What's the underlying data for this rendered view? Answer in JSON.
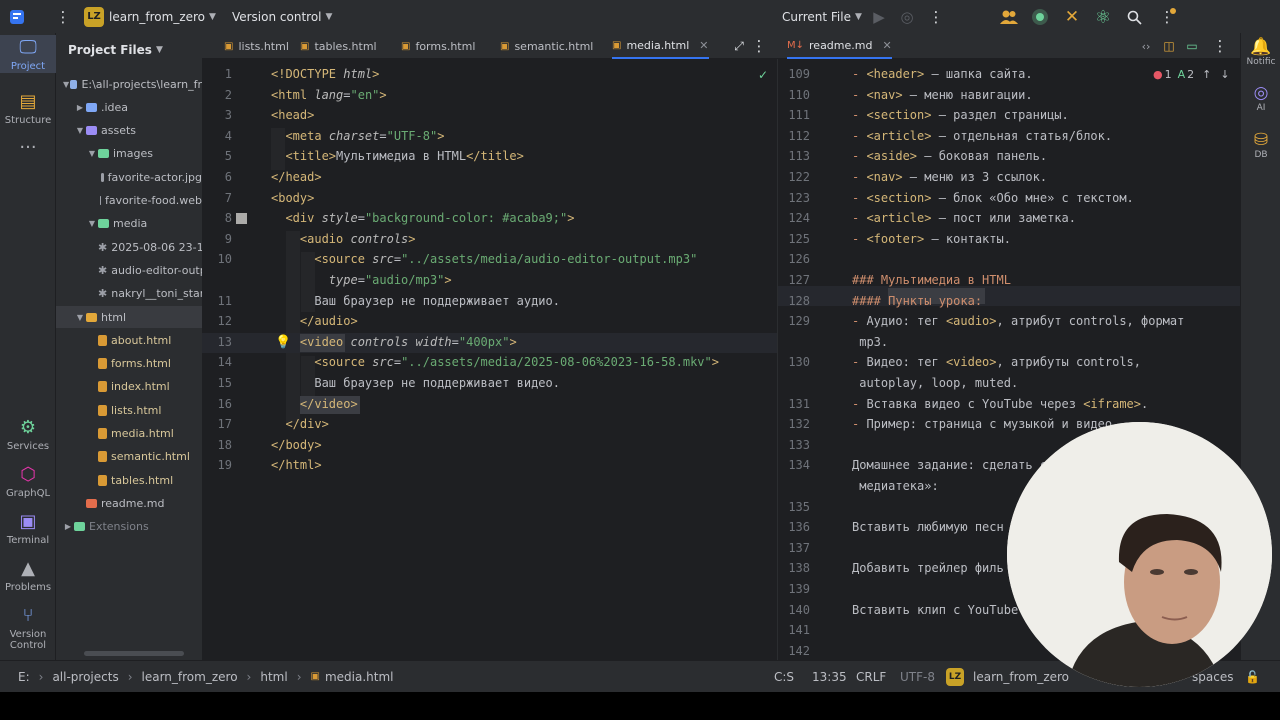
{
  "titlebar": {
    "project_badge": "LZ",
    "project_name": "learn_from_zero",
    "vcs": "Version control",
    "run_config": "Current File"
  },
  "left_tools": [
    {
      "label": "Project",
      "icon": "monitor-icon"
    },
    {
      "label": "Structure",
      "icon": "structure-icon"
    },
    {
      "label": "Services",
      "icon": "gear-icon"
    },
    {
      "label": "GraphQL",
      "icon": "graphql-icon"
    },
    {
      "label": "Terminal",
      "icon": "terminal-icon"
    },
    {
      "label": "Problems",
      "icon": "warning-icon"
    },
    {
      "label": "Version Control",
      "icon": "branch-icon"
    }
  ],
  "project_panel": {
    "title": "Project Files",
    "tree": [
      {
        "label": "E:\\all-projects\\learn_fr",
        "level": 0,
        "kind": "folder-root"
      },
      {
        "label": ".idea",
        "level": 1,
        "kind": "folder"
      },
      {
        "label": "assets",
        "level": 1,
        "kind": "folder"
      },
      {
        "label": "images",
        "level": 2,
        "kind": "folder"
      },
      {
        "label": "favorite-actor.jpg",
        "level": 3,
        "kind": "image"
      },
      {
        "label": "favorite-food.web",
        "level": 3,
        "kind": "image"
      },
      {
        "label": "media",
        "level": 2,
        "kind": "folder"
      },
      {
        "label": "2025-08-06 23-1",
        "level": 3,
        "kind": "media"
      },
      {
        "label": "audio-editor-outp",
        "level": 3,
        "kind": "media"
      },
      {
        "label": "nakryl__toni_stark",
        "level": 3,
        "kind": "media"
      },
      {
        "label": "html",
        "level": 1,
        "kind": "folder"
      },
      {
        "label": "about.html",
        "level": 2,
        "kind": "html"
      },
      {
        "label": "forms.html",
        "level": 2,
        "kind": "html"
      },
      {
        "label": "index.html",
        "level": 2,
        "kind": "html"
      },
      {
        "label": "lists.html",
        "level": 2,
        "kind": "html"
      },
      {
        "label": "media.html",
        "level": 2,
        "kind": "html"
      },
      {
        "label": "semantic.html",
        "level": 2,
        "kind": "html"
      },
      {
        "label": "tables.html",
        "level": 2,
        "kind": "html"
      },
      {
        "label": "readme.md",
        "level": 1,
        "kind": "md"
      },
      {
        "label": "Extensions",
        "level": 0,
        "kind": "ext"
      }
    ]
  },
  "tabs_left": [
    "lists.html",
    "tables.html",
    "forms.html",
    "semantic.html",
    "media.html"
  ],
  "active_tab": "media.html",
  "tab_right": "readme.md",
  "editor_left": {
    "lines": [
      {
        "n": "1",
        "html": "<span class=\"t\">&lt;!DOCTYPE </span><span class=\"a\">html</span><span class=\"t\">&gt;</span>"
      },
      {
        "n": "2",
        "html": "<span class=\"t\">&lt;html </span><span class=\"a\">lang</span>=<span class=\"s\">\"en\"</span><span class=\"t\">&gt;</span>"
      },
      {
        "n": "3",
        "html": "<span class=\"t\">&lt;head&gt;</span>"
      },
      {
        "n": "4",
        "html": "  <span class=\"t\">&lt;meta </span><span class=\"a\">charset</span>=<span class=\"s\">\"UTF-8\"</span><span class=\"t\">&gt;</span>"
      },
      {
        "n": "5",
        "html": "  <span class=\"t\">&lt;title&gt;</span>Мультимедиа в HTML<span class=\"t\">&lt;/title&gt;</span>"
      },
      {
        "n": "6",
        "html": "<span class=\"t\">&lt;/head&gt;</span>"
      },
      {
        "n": "7",
        "html": "<span class=\"t\">&lt;body&gt;</span>"
      },
      {
        "n": "8",
        "html": "  <span class=\"t\">&lt;div </span><span class=\"a\">style</span>=<span class=\"s\">\"background-color: #acaba9;\"</span><span class=\"t\">&gt;</span>"
      },
      {
        "n": "9",
        "html": "    <span class=\"t\">&lt;audio </span><span class=\"a\">controls</span><span class=\"t\">&gt;</span>"
      },
      {
        "n": "10",
        "html": "      <span class=\"t\">&lt;source </span><span class=\"a\">src</span>=<span class=\"s\">\"../assets/media/audio-editor-output.mp3\"</span>"
      },
      {
        "n": "",
        "html": "        <span class=\"a\">type</span>=<span class=\"s\">\"audio/mp3\"</span><span class=\"t\">&gt;</span>"
      },
      {
        "n": "11",
        "html": "      Ваш браузер не поддерживает аудио."
      },
      {
        "n": "12",
        "html": "    <span class=\"t\">&lt;/audio&gt;</span>"
      },
      {
        "n": "13",
        "html": "    <span class=\"t\">&lt;video </span><span class=\"a\">controls</span> <span class=\"a\">width</span>=<span class=\"s\">\"400px\"</span><span class=\"t\">&gt;</span>"
      },
      {
        "n": "14",
        "html": "      <span class=\"t\">&lt;source </span><span class=\"a\">src</span>=<span class=\"s\">\"../assets/media/2025-08-06%2023-16-58.mkv\"</span><span class=\"t\">&gt;</span>"
      },
      {
        "n": "15",
        "html": "      Ваш браузер не поддерживает видео."
      },
      {
        "n": "16",
        "html": "    <span class=\"t\">&lt;/video&gt;</span>"
      },
      {
        "n": "17",
        "html": "  <span class=\"t\">&lt;/div&gt;</span>"
      },
      {
        "n": "18",
        "html": "<span class=\"t\">&lt;/body&gt;</span>"
      },
      {
        "n": "19",
        "html": "<span class=\"t\">&lt;/html&gt;</span>"
      }
    ]
  },
  "editor_right": {
    "problems": "1",
    "warnings": "2",
    "lines": [
      {
        "n": "109",
        "html": "<span class=\"bul\">- </span><span class=\"t\">&lt;header&gt;</span> — шапка сайта."
      },
      {
        "n": "110",
        "html": "<span class=\"bul\">- </span><span class=\"t\">&lt;nav&gt;</span> — меню навигации."
      },
      {
        "n": "111",
        "html": "<span class=\"bul\">- </span><span class=\"t\">&lt;section&gt;</span> — раздел страницы."
      },
      {
        "n": "112",
        "html": "<span class=\"bul\">- </span><span class=\"t\">&lt;article&gt;</span> — отдельная статья/блок."
      },
      {
        "n": "113",
        "html": "<span class=\"bul\">- </span><span class=\"t\">&lt;aside&gt;</span> — боковая панель."
      },
      {
        "n": "122",
        "html": "<span class=\"bul\">- </span><span class=\"t\">&lt;nav&gt;</span> — меню из 3 ссылок."
      },
      {
        "n": "123",
        "html": "<span class=\"bul\">- </span><span class=\"t\">&lt;section&gt;</span> — блок «Обо мне» с текстом."
      },
      {
        "n": "124",
        "html": "<span class=\"bul\">- </span><span class=\"t\">&lt;article&gt;</span> — пост или заметка."
      },
      {
        "n": "125",
        "html": "<span class=\"bul\">- </span><span class=\"t\">&lt;footer&gt;</span> — контакты."
      },
      {
        "n": "126",
        "html": ""
      },
      {
        "n": "127",
        "html": "<span class=\"h\">### Мультимедиа в HTML</span>"
      },
      {
        "n": "128",
        "html": "<span class=\"h\">#### Пункты урока:</span>"
      },
      {
        "n": "129",
        "html": "<span class=\"bul\">- </span>Аудио: тег <span class=\"t\">&lt;audio&gt;</span>, атрибут controls, формат"
      },
      {
        "n": "",
        "html": " mp3."
      },
      {
        "n": "130",
        "html": "<span class=\"bul\">- </span>Видео: тег <span class=\"t\">&lt;video&gt;</span>, атрибуты controls,"
      },
      {
        "n": "",
        "html": " autoplay, loop, muted."
      },
      {
        "n": "131",
        "html": "<span class=\"bul\">- </span>Вставка видео с YouTube через <span class=\"t\">&lt;iframe&gt;</span>."
      },
      {
        "n": "132",
        "html": "<span class=\"bul\">- </span>Пример: страница с музыкой и видео."
      },
      {
        "n": "133",
        "html": ""
      },
      {
        "n": "134",
        "html": "Домашнее задание: сделать с"
      },
      {
        "n": "",
        "html": " медиатека»:"
      },
      {
        "n": "135",
        "html": ""
      },
      {
        "n": "136",
        "html": "Вставить любимую песн"
      },
      {
        "n": "137",
        "html": ""
      },
      {
        "n": "138",
        "html": "Добавить трейлер филь"
      },
      {
        "n": "139",
        "html": ""
      },
      {
        "n": "140",
        "html": "Вставить клип с YouTube"
      },
      {
        "n": "141",
        "html": ""
      },
      {
        "n": "142",
        "html": ""
      }
    ]
  },
  "right_tools": [
    {
      "label": "Notific",
      "icon": "bell-icon"
    },
    {
      "label": "AI",
      "icon": "ai-icon"
    },
    {
      "label": "DB",
      "icon": "database-icon"
    }
  ],
  "statusbar": {
    "breadcrumbs": [
      "E:",
      "all-projects",
      "learn_from_zero",
      "html",
      "media.html"
    ],
    "position": "13:35",
    "line_ending": "CRLF",
    "encoding": "UTF-8",
    "project": "learn_from_zero",
    "indent": "spaces",
    "cursor_mark": "C:S"
  },
  "colors": {
    "accent": "#3574f0",
    "tag": "#d5b778",
    "string": "#6aab73",
    "keyword": "#cf8e6d",
    "badge": "#c9a227"
  }
}
